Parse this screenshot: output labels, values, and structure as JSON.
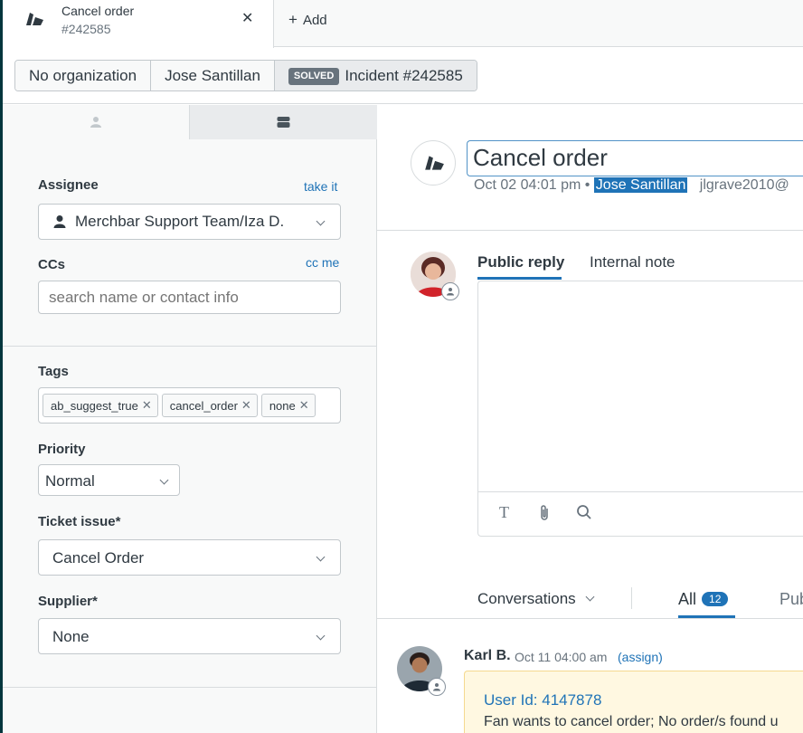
{
  "tab": {
    "title": "Cancel order",
    "subtitle": "#242585",
    "close_icon": "close-icon",
    "add_label": "Add"
  },
  "breadcrumb": {
    "organization": "No organization",
    "requester": "Jose Santillan",
    "status_badge": "SOLVED",
    "ticket": "Incident #242585"
  },
  "sidebar": {
    "tabs": [
      "user-icon",
      "ticket-icon"
    ],
    "assignee": {
      "label": "Assignee",
      "action": "take it",
      "value": "Merchbar Support Team/Iza D."
    },
    "ccs": {
      "label": "CCs",
      "action": "cc me",
      "placeholder": "search name or contact info"
    },
    "tags": {
      "label": "Tags",
      "items": [
        "ab_suggest_true",
        "cancel_order",
        "none"
      ]
    },
    "priority": {
      "label": "Priority",
      "value": "Normal"
    },
    "ticket_issue": {
      "label": "Ticket issue*",
      "value": "Cancel Order"
    },
    "supplier": {
      "label": "Supplier*",
      "value": "None"
    }
  },
  "ticket": {
    "subject": "Cancel order",
    "meta_date": "Oct 02 04:01 pm •",
    "meta_requester": "Jose Santillan",
    "meta_email": "jlgrave2010@"
  },
  "composer": {
    "public_reply": "Public reply",
    "internal_note": "Internal note",
    "tools": [
      "text-format-icon",
      "attachment-icon",
      "search-icon"
    ]
  },
  "conversation": {
    "filter_label": "Conversations",
    "all_label": "All",
    "all_count": "12",
    "public_label": "Pub",
    "comment": {
      "author": "Karl B.",
      "time": "Oct 11 04:00 am",
      "assign": "(assign)",
      "line1": "User Id: 4147878",
      "line2": "Fan wants to cancel order; No order/s found u"
    }
  },
  "colors": {
    "accent": "#1f73b7",
    "sidebar_bg": "#f8f9f9",
    "note_bg": "#fff8e1",
    "status_badge": "#68737d"
  }
}
